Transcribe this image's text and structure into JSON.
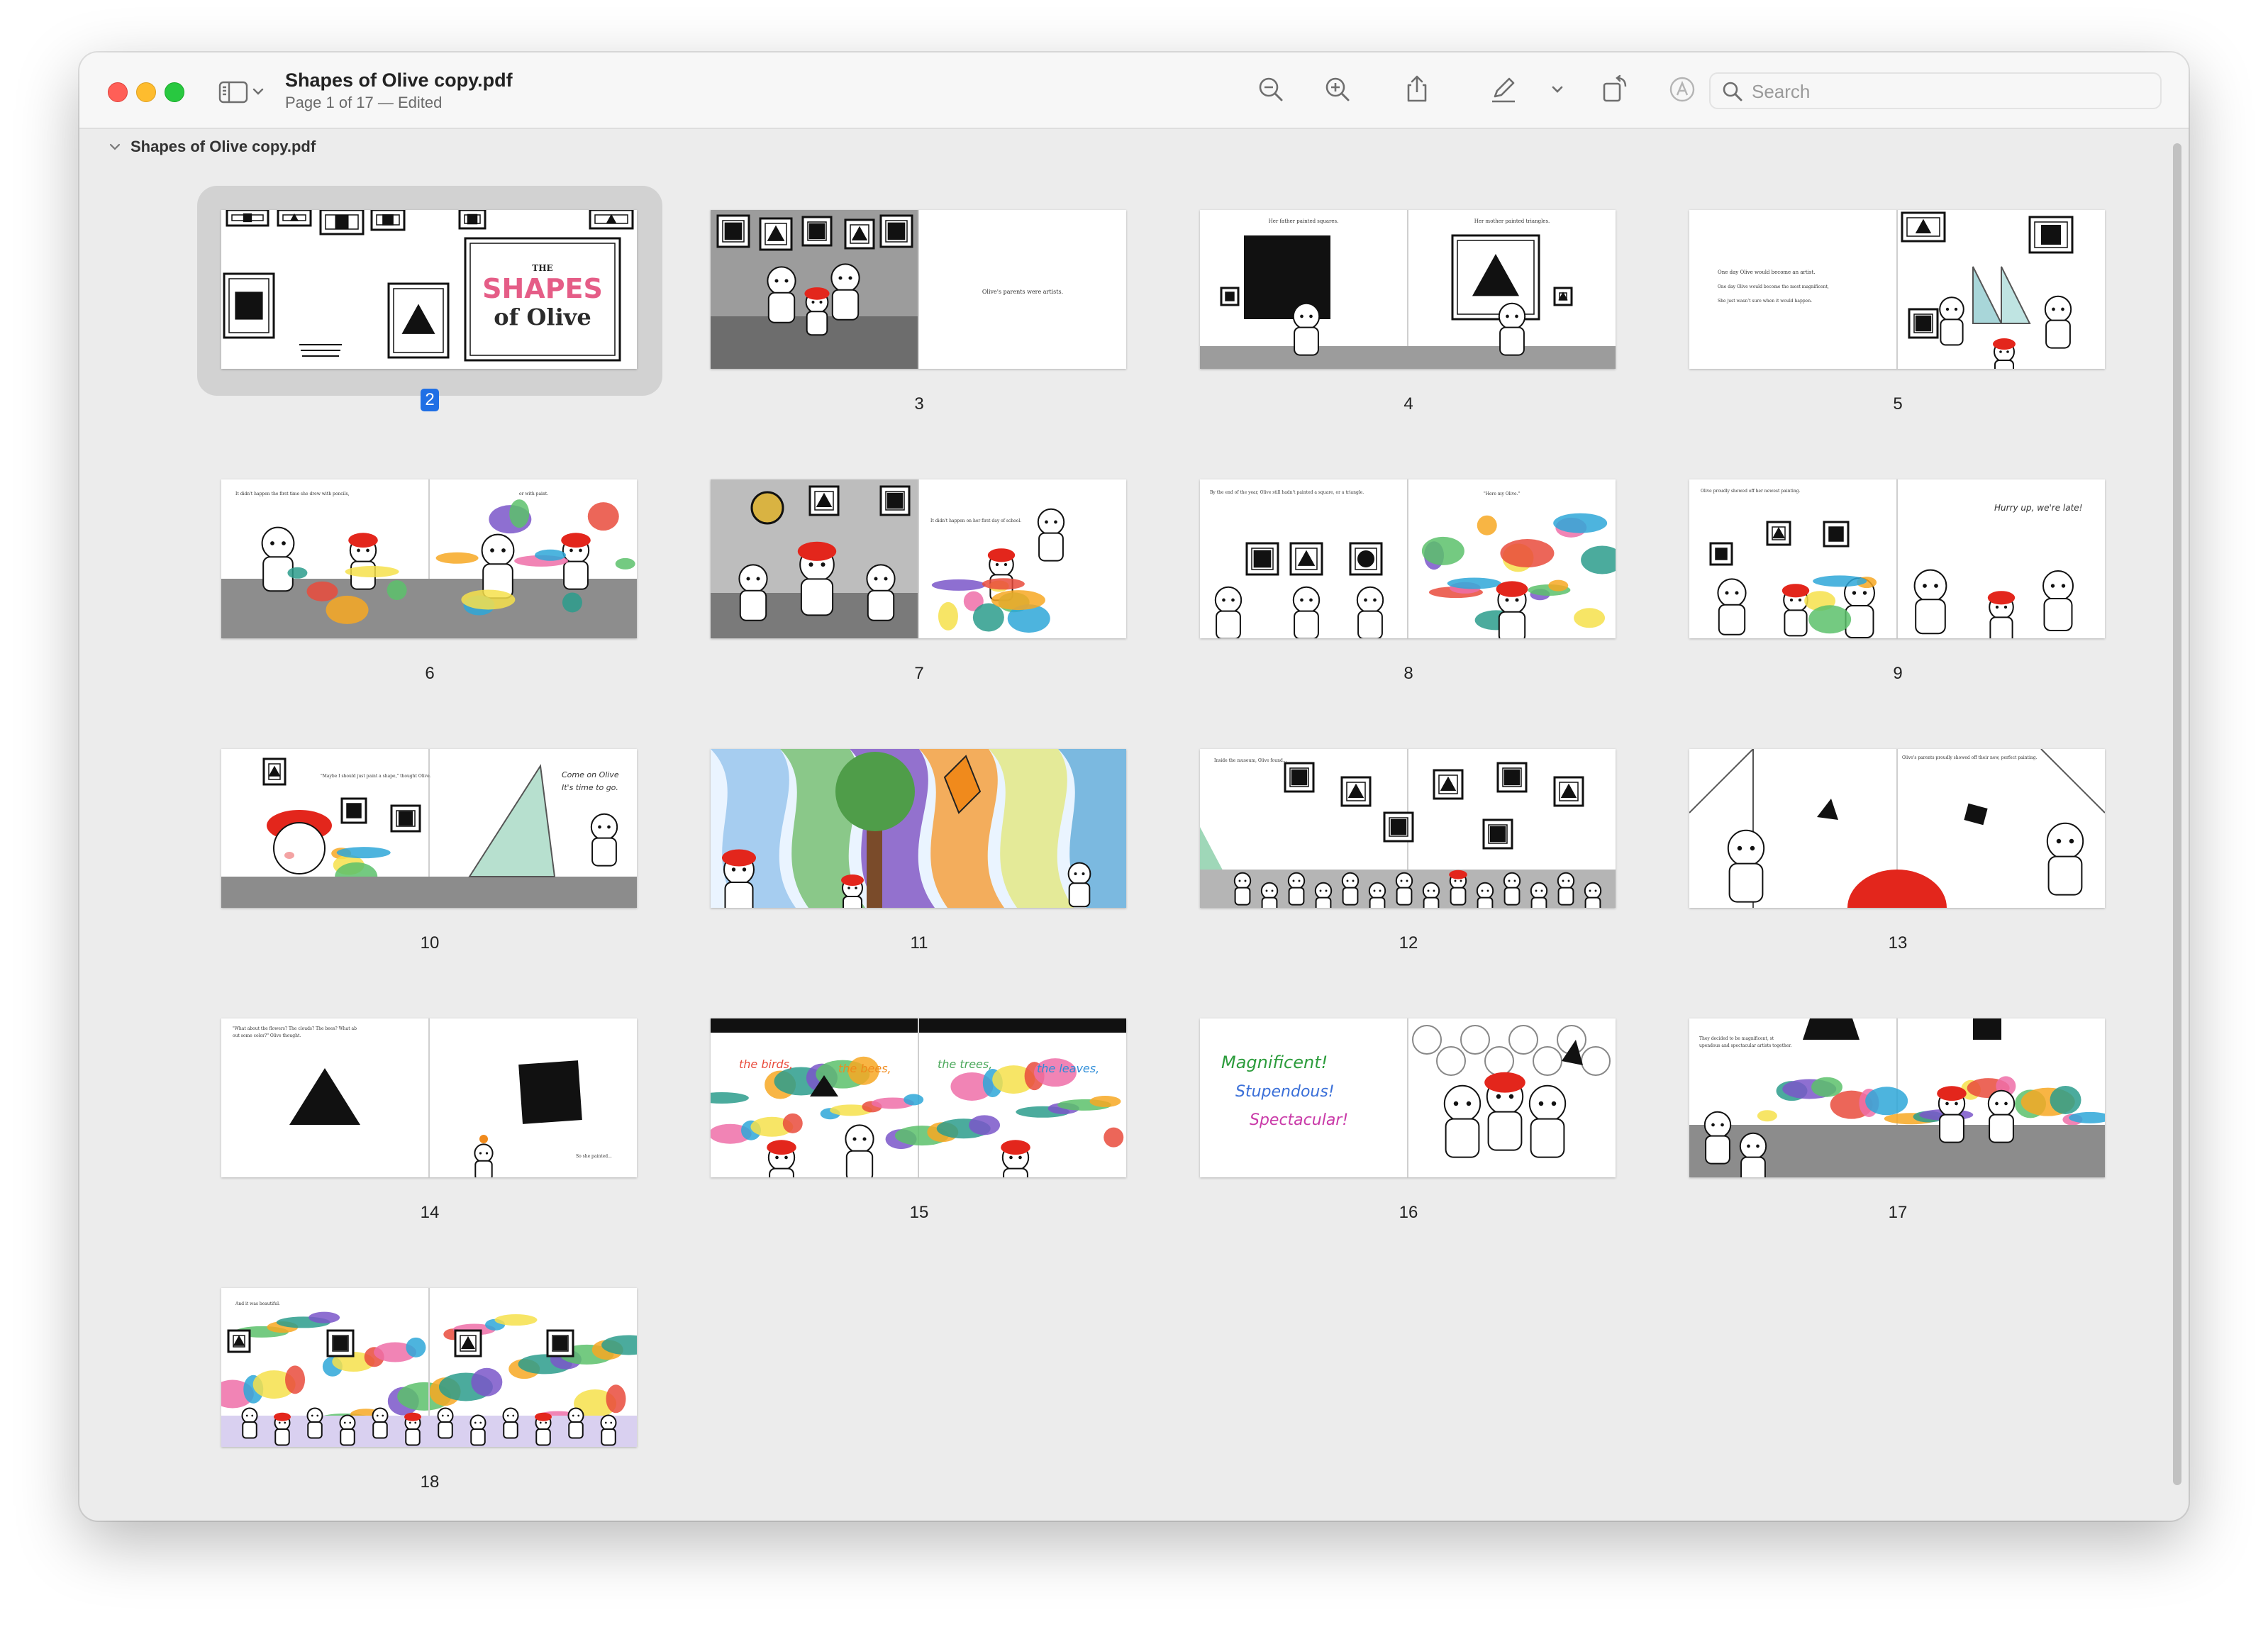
{
  "window": {
    "title": "Shapes of Olive copy.pdf",
    "subtitle": "Page 1 of 17 — Edited"
  },
  "toolbar": {
    "icons": [
      "sidebar-icon",
      "chevron-down-icon",
      "zoom-out-icon",
      "zoom-in-icon",
      "share-icon",
      "markup-pen-icon",
      "chevron-down-icon",
      "rotate-icon",
      "accessibility-circle-icon"
    ],
    "search_placeholder": "Search"
  },
  "sidebar": {
    "section_label": "Shapes of Olive copy.pdf"
  },
  "thumbnails": {
    "selected": "2",
    "pages": [
      {
        "num": "2",
        "art": "title",
        "text": "",
        "headline": "THE SHAPES of Olive"
      },
      {
        "num": "3",
        "art": "family",
        "text": "Olive's parents were artists."
      },
      {
        "num": "4",
        "art": "easels",
        "text": "Her father painted squares.",
        "text2": "Her mother painted triangles."
      },
      {
        "num": "5",
        "art": "wishes",
        "text": "One day Olive would become an artist."
      },
      {
        "num": "6",
        "art": "kitchen",
        "text": "It didn't happen the first time she drew with pencils,",
        "text2": "or with paint."
      },
      {
        "num": "7",
        "art": "school",
        "text": "It didn't happen on her first day of school."
      },
      {
        "num": "8",
        "art": "classroom",
        "text": "By the end of the year, Olive still hadn't painted a square, or a triangle.",
        "text2": "\"Here my Olive.\""
      },
      {
        "num": "9",
        "art": "dance",
        "text": "Olive proudly showed off her newest painting.",
        "text2": "Hurry up, we're late!"
      },
      {
        "num": "10",
        "art": "museum",
        "text": "\"Maybe I should just paint a shape,\" thought Olive.",
        "text2": "Come on Olive. It's time to go."
      },
      {
        "num": "11",
        "art": "nature",
        "text": ""
      },
      {
        "num": "12",
        "art": "crowd",
        "text": "Inside the museum, Olive found..."
      },
      {
        "num": "13",
        "art": "gallery",
        "text": "Olive's parents proudly showed off their new, perfect painting."
      },
      {
        "num": "14",
        "art": "shapes",
        "text": "\"What about the flowers? The clouds? The bees? What about some color?\" Olive thought.",
        "text2": "So she painted..."
      },
      {
        "num": "15",
        "art": "rainbow",
        "text": "the birds,",
        "text2": "the bees,",
        "text3": "the trees,",
        "text4": "the leaves,"
      },
      {
        "num": "16",
        "art": "magnificent",
        "text": "Magnificent!",
        "text2": "Stupendous!",
        "text3": "Spectacular!"
      },
      {
        "num": "17",
        "art": "mural",
        "text": "They decided to be magnificent, stupendous and spectacular artists together."
      },
      {
        "num": "18",
        "art": "finale",
        "text": "And it was beautiful."
      }
    ]
  },
  "colors": {
    "accent": "#1f6fe5",
    "olive_hat": "#e3261c",
    "window_bg": "#ececec",
    "toolbar_bg": "#f7f7f7"
  }
}
